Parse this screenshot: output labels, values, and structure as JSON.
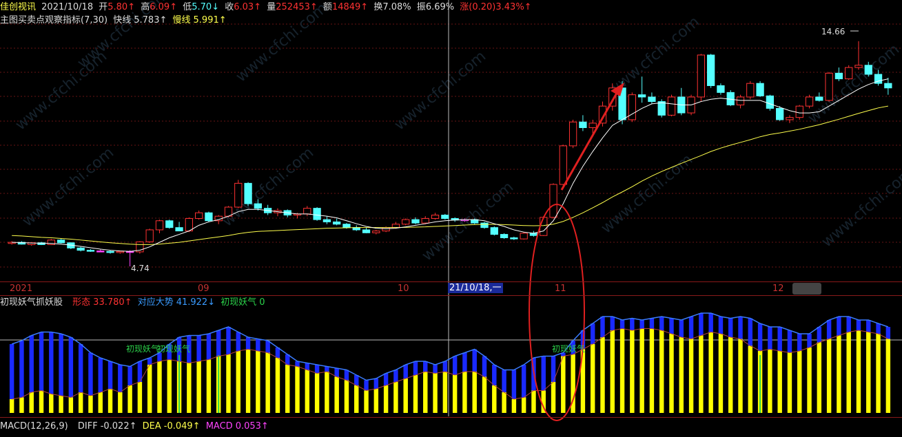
{
  "header": {
    "stock_name": "佳创视讯",
    "date": "2021/10/18",
    "open_label": "开",
    "open": "5.80↑",
    "high_label": "高",
    "high": "6.09↑",
    "low_label": "低",
    "low": "5.70↓",
    "close_label": "收",
    "close": "6.03↑",
    "volume_label": "量",
    "volume": "252453↑",
    "amount_label": "额",
    "amount": "14849↑",
    "turnover_label": "换",
    "turnover": "7.08%",
    "amplitude_label": "振",
    "amplitude": "6.69%",
    "change_label": "涨",
    "change": "(0.20)3.43%↑"
  },
  "main_indicator": {
    "name": "主图买卖点观察指标(7,30)",
    "fast_label": "快线",
    "fast": "5.783↑",
    "slow_label": "慢线",
    "slow": "5.991↑"
  },
  "peak_label": "14.66",
  "low_label": "4.74",
  "date_axis": {
    "ticks": [
      "2021",
      "09",
      "10",
      "11",
      "12"
    ],
    "cursor": "21/10/18,一"
  },
  "sub_indicator": {
    "name": "初现妖气抓妖股",
    "form_label": "形态",
    "form": "33.780↑",
    "trend_label": "对应大势",
    "trend": "41.922↓",
    "signal_label": "初现妖气",
    "signal": "0",
    "signal_tags": [
      "初现妖气",
      "初现妖气",
      "初现妖气"
    ]
  },
  "macd": {
    "name": "MACD(12,26,9)",
    "diff_label": "DIFF",
    "diff": "-0.022↑",
    "dea_label": "DEA",
    "dea": "-0.049↑",
    "macd_label": "MACD",
    "macd": "0.053↑"
  },
  "watermark": "www.cfchi.com",
  "colors": {
    "up_candle": "#ff3232",
    "down_candle": "#54ffff",
    "doji": "#ff44ff",
    "fast_line": "#ffffff",
    "slow_line": "#ffff4c",
    "bar_yellow": "#ffff00",
    "bar_blue": "#1a2aff",
    "bar_red": "#ff1a1a",
    "bar_green": "#2bd24a",
    "annotation": "#e02020"
  },
  "chart_data": [
    {
      "type": "candlestick",
      "title": "",
      "ohlc": [
        [
          5.75,
          5.85,
          5.7,
          5.8
        ],
        [
          5.8,
          5.85,
          5.7,
          5.72
        ],
        [
          5.7,
          5.8,
          5.65,
          5.78
        ],
        [
          5.78,
          5.82,
          5.68,
          5.7
        ],
        [
          5.7,
          5.95,
          5.68,
          5.9
        ],
        [
          5.9,
          5.95,
          5.75,
          5.78
        ],
        [
          5.78,
          5.8,
          5.5,
          5.55
        ],
        [
          5.55,
          5.6,
          5.4,
          5.45
        ],
        [
          5.45,
          5.5,
          5.38,
          5.42
        ],
        [
          5.42,
          5.48,
          5.38,
          5.4
        ],
        [
          5.4,
          5.45,
          5.3,
          5.35
        ],
        [
          5.35,
          5.42,
          5.3,
          5.4
        ],
        [
          5.4,
          5.45,
          4.74,
          5.38
        ],
        [
          5.38,
          5.85,
          5.3,
          5.82
        ],
        [
          5.82,
          6.4,
          5.78,
          6.35
        ],
        [
          6.35,
          6.8,
          6.2,
          6.75
        ],
        [
          6.75,
          6.8,
          6.4,
          6.45
        ],
        [
          6.45,
          6.7,
          6.3,
          6.3
        ],
        [
          6.3,
          6.9,
          6.25,
          6.85
        ],
        [
          6.85,
          7.2,
          6.8,
          7.1
        ],
        [
          7.1,
          7.15,
          6.7,
          6.75
        ],
        [
          6.75,
          7.0,
          6.6,
          6.95
        ],
        [
          6.95,
          7.4,
          6.9,
          7.35
        ],
        [
          7.35,
          8.55,
          7.3,
          8.4
        ],
        [
          8.4,
          8.45,
          7.4,
          7.5
        ],
        [
          7.5,
          7.7,
          7.2,
          7.3
        ],
        [
          7.3,
          7.45,
          7.0,
          7.1
        ],
        [
          7.1,
          7.3,
          6.95,
          7.2
        ],
        [
          7.2,
          7.25,
          6.9,
          7.0
        ],
        [
          7.0,
          7.1,
          6.85,
          7.05
        ],
        [
          7.05,
          7.4,
          6.95,
          7.3
        ],
        [
          7.3,
          7.35,
          6.75,
          6.8
        ],
        [
          6.8,
          6.95,
          6.6,
          6.7
        ],
        [
          6.7,
          6.85,
          6.55,
          6.6
        ],
        [
          6.6,
          6.65,
          6.4,
          6.45
        ],
        [
          6.45,
          6.55,
          6.3,
          6.35
        ],
        [
          6.35,
          6.45,
          6.2,
          6.22
        ],
        [
          6.22,
          6.35,
          6.15,
          6.3
        ],
        [
          6.3,
          6.5,
          6.25,
          6.45
        ],
        [
          6.45,
          6.7,
          6.4,
          6.6
        ],
        [
          6.6,
          6.85,
          6.55,
          6.8
        ],
        [
          6.8,
          6.9,
          6.6,
          6.65
        ],
        [
          6.65,
          6.95,
          6.6,
          6.85
        ],
        [
          6.85,
          7.1,
          6.8,
          7.0
        ],
        [
          7.0,
          7.05,
          6.8,
          6.85
        ],
        [
          6.85,
          6.9,
          6.7,
          6.78
        ],
        [
          6.78,
          6.85,
          6.7,
          6.8
        ],
        [
          6.8,
          6.85,
          6.6,
          6.65
        ],
        [
          6.65,
          6.7,
          6.4,
          6.45
        ],
        [
          6.45,
          6.5,
          6.1,
          6.15
        ],
        [
          6.15,
          6.2,
          5.95,
          6.0
        ],
        [
          6.0,
          6.05,
          5.9,
          5.95
        ],
        [
          5.95,
          6.25,
          5.92,
          6.2
        ],
        [
          6.2,
          6.3,
          6.05,
          6.1
        ],
        [
          6.1,
          6.95,
          6.08,
          6.9
        ],
        [
          6.9,
          8.4,
          6.85,
          8.35
        ],
        [
          8.35,
          10.1,
          8.3,
          10.05
        ],
        [
          10.05,
          11.2,
          9.95,
          11.1
        ],
        [
          11.1,
          11.4,
          10.7,
          10.85
        ],
        [
          10.85,
          11.2,
          10.6,
          11.05
        ],
        [
          11.05,
          12.0,
          10.9,
          11.8
        ],
        [
          11.8,
          12.8,
          11.6,
          12.6
        ],
        [
          12.6,
          12.9,
          11.0,
          11.2
        ],
        [
          11.2,
          12.4,
          11.1,
          12.3
        ],
        [
          12.3,
          13.1,
          11.95,
          12.2
        ],
        [
          12.2,
          12.4,
          11.9,
          12.0
        ],
        [
          12.0,
          12.1,
          11.3,
          11.4
        ],
        [
          11.4,
          12.3,
          11.35,
          12.2
        ],
        [
          12.2,
          12.6,
          11.4,
          11.5
        ],
        [
          11.5,
          12.3,
          11.4,
          12.2
        ],
        [
          12.2,
          14.1,
          12.0,
          14.05
        ],
        [
          14.05,
          14.1,
          12.6,
          12.7
        ],
        [
          12.7,
          12.8,
          12.3,
          12.4
        ],
        [
          12.4,
          12.5,
          11.8,
          11.85
        ],
        [
          11.85,
          12.3,
          11.7,
          12.2
        ],
        [
          12.2,
          12.9,
          12.1,
          12.8
        ],
        [
          12.8,
          12.9,
          12.2,
          12.25
        ],
        [
          12.25,
          12.3,
          11.6,
          11.7
        ],
        [
          11.7,
          11.8,
          11.15,
          11.2
        ],
        [
          11.2,
          11.4,
          11.05,
          11.3
        ],
        [
          11.3,
          11.85,
          11.2,
          11.8
        ],
        [
          11.8,
          12.3,
          11.7,
          12.2
        ],
        [
          12.2,
          12.4,
          12.0,
          12.05
        ],
        [
          12.05,
          13.3,
          12.0,
          13.25
        ],
        [
          13.25,
          13.5,
          12.9,
          13.0
        ],
        [
          13.0,
          13.6,
          12.95,
          13.5
        ],
        [
          13.5,
          14.66,
          13.4,
          13.6
        ],
        [
          13.6,
          13.75,
          13.1,
          13.2
        ],
        [
          13.2,
          13.4,
          12.7,
          12.8
        ],
        [
          12.8,
          13.05,
          12.3,
          12.6
        ]
      ],
      "fast_line": [
        5.8,
        5.79,
        5.77,
        5.76,
        5.75,
        5.72,
        5.68,
        5.62,
        5.56,
        5.5,
        5.45,
        5.42,
        5.4,
        5.45,
        5.6,
        5.8,
        6.0,
        6.15,
        6.3,
        6.55,
        6.7,
        6.8,
        6.95,
        7.15,
        7.25,
        7.25,
        7.2,
        7.15,
        7.1,
        7.05,
        7.05,
        7.0,
        6.95,
        6.88,
        6.75,
        6.62,
        6.5,
        6.42,
        6.4,
        6.42,
        6.48,
        6.55,
        6.62,
        6.7,
        6.75,
        6.78,
        6.8,
        6.8,
        6.75,
        6.62,
        6.5,
        6.35,
        6.25,
        6.2,
        6.3,
        6.75,
        7.5,
        8.4,
        9.15,
        9.8,
        10.4,
        10.95,
        11.2,
        11.45,
        11.7,
        11.9,
        11.95,
        11.9,
        11.85,
        11.85,
        12.0,
        12.1,
        12.15,
        12.1,
        12.05,
        12.05,
        12.05,
        11.9,
        11.75,
        11.6,
        11.5,
        11.5,
        11.55,
        11.8,
        12.05,
        12.3,
        12.55,
        12.75,
        12.9,
        13.0
      ],
      "slow_line": [
        6.1,
        6.08,
        6.05,
        6.02,
        6.0,
        5.97,
        5.94,
        5.9,
        5.86,
        5.82,
        5.78,
        5.75,
        5.72,
        5.7,
        5.7,
        5.72,
        5.76,
        5.8,
        5.86,
        5.92,
        5.98,
        6.04,
        6.1,
        6.18,
        6.24,
        6.28,
        6.3,
        6.32,
        6.34,
        6.36,
        6.38,
        6.4,
        6.42,
        6.43,
        6.44,
        6.45,
        6.45,
        6.45,
        6.45,
        6.45,
        6.46,
        6.47,
        6.48,
        6.5,
        6.52,
        6.54,
        6.56,
        6.58,
        6.59,
        6.59,
        6.58,
        6.56,
        6.54,
        6.53,
        6.54,
        6.6,
        6.72,
        6.9,
        7.1,
        7.32,
        7.55,
        7.8,
        8.02,
        8.25,
        8.5,
        8.72,
        8.92,
        9.1,
        9.28,
        9.45,
        9.62,
        9.8,
        9.95,
        10.08,
        10.2,
        10.32,
        10.45,
        10.55,
        10.62,
        10.7,
        10.78,
        10.88,
        10.98,
        11.1,
        11.22,
        11.35,
        11.48,
        11.6,
        11.72,
        11.8
      ],
      "ylim": [
        4.5,
        15.2
      ],
      "x_ticks": [
        "2021",
        "09",
        "10",
        "11",
        "12"
      ]
    },
    {
      "type": "bar",
      "title": "初现妖气抓妖股",
      "series": [
        {
          "name": "形态",
          "values": [
            8,
            9,
            12,
            13,
            11,
            10,
            9,
            12,
            10,
            12,
            14,
            12,
            16,
            18,
            28,
            30,
            31,
            30,
            29,
            30,
            31,
            33,
            34,
            36,
            37,
            36,
            35,
            32,
            28,
            27,
            25,
            23,
            24,
            21,
            19,
            16,
            13,
            14,
            16,
            18,
            20,
            22,
            24,
            23,
            24,
            22,
            24,
            24,
            21,
            16,
            12,
            8,
            9,
            13,
            13,
            18,
            33,
            34,
            37,
            40,
            44,
            48,
            49,
            48,
            49,
            49,
            48,
            46,
            44,
            43,
            45,
            47,
            46,
            44,
            43,
            39,
            36,
            37,
            36,
            35,
            36,
            38,
            41,
            43,
            45,
            47,
            48,
            47,
            46,
            43
          ]
        },
        {
          "name": "对应大势",
          "values": [
            40,
            42,
            45,
            47,
            47,
            46,
            44,
            40,
            35,
            32,
            30,
            28,
            27,
            30,
            32,
            35,
            40,
            44,
            45,
            45,
            46,
            48,
            50,
            47,
            44,
            43,
            42,
            38,
            34,
            30,
            29,
            28,
            27,
            26,
            25,
            22,
            19,
            20,
            23,
            25,
            28,
            30,
            30,
            28,
            30,
            33,
            35,
            37,
            33,
            28,
            25,
            25,
            28,
            32,
            33,
            33,
            35,
            42,
            48,
            52,
            56,
            56,
            54,
            55,
            54,
            55,
            56,
            55,
            54,
            56,
            58,
            58,
            56,
            55,
            56,
            55,
            52,
            50,
            50,
            48,
            46,
            46,
            50,
            54,
            56,
            56,
            54,
            54,
            52,
            50
          ]
        },
        {
          "name": "初现妖气",
          "values": [
            0,
            0,
            0,
            0,
            0,
            0,
            0,
            0,
            0,
            0,
            0,
            0,
            0,
            0,
            0,
            0,
            0,
            0,
            0,
            0,
            0,
            0,
            0,
            0,
            0,
            0,
            0,
            0,
            0,
            0,
            0,
            0,
            0,
            0,
            0,
            0,
            0,
            0,
            0,
            0,
            0,
            0,
            0,
            0,
            0,
            0,
            0,
            0,
            0,
            0,
            0,
            0,
            0,
            0,
            0,
            0,
            0,
            0,
            0,
            0,
            0,
            0,
            0,
            0,
            0,
            0,
            0,
            0,
            0,
            0,
            0,
            0,
            0,
            0,
            0,
            0,
            0,
            0,
            0,
            0,
            0,
            0,
            0,
            0,
            0,
            0,
            0,
            0,
            0,
            0
          ]
        }
      ],
      "ylim": [
        0,
        60
      ]
    }
  ]
}
